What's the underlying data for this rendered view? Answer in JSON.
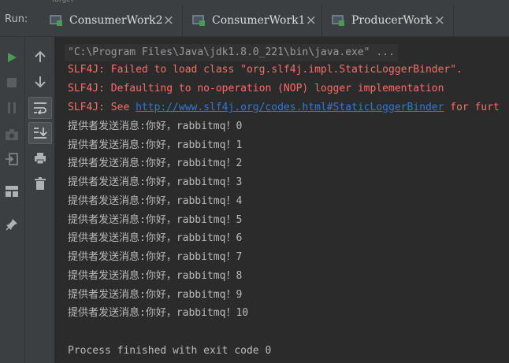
{
  "tool_window": {
    "run_label": "Run:",
    "tabs": [
      {
        "title": "ConsumerWork2"
      },
      {
        "title": "ConsumerWork1"
      },
      {
        "title": "ProducerWork"
      }
    ],
    "header_fragment": "target"
  },
  "console": {
    "command_line": "\"C:\\Program Files\\Java\\jdk1.8.0_221\\bin\\java.exe\" ...",
    "errors": [
      "SLF4J: Failed to load class \"org.slf4j.impl.StaticLoggerBinder\".",
      "SLF4J: Defaulting to no-operation (NOP) logger implementation"
    ],
    "see_prefix": "SLF4J: See ",
    "see_link": "http://www.slf4j.org/codes.html#StaticLoggerBinder",
    "see_suffix": " for furt",
    "messages": [
      "提供者发送消息:你好，rabbitmq！0",
      "提供者发送消息:你好，rabbitmq！1",
      "提供者发送消息:你好，rabbitmq！2",
      "提供者发送消息:你好，rabbitmq！3",
      "提供者发送消息:你好，rabbitmq！4",
      "提供者发送消息:你好，rabbitmq！5",
      "提供者发送消息:你好，rabbitmq！6",
      "提供者发送消息:你好，rabbitmq！7",
      "提供者发送消息:你好，rabbitmq！8",
      "提供者发送消息:你好，rabbitmq！9",
      "提供者发送消息:你好，rabbitmq！10"
    ],
    "exit_message": "Process finished with exit code 0"
  },
  "colors": {
    "error": "#ff6b68",
    "link": "#287bde",
    "run_green": "#499c54"
  },
  "icons": {
    "left_gutter": [
      "run-icon",
      "stop-icon",
      "pause-icon",
      "camera-icon",
      "exit-icon",
      "layout-icon",
      "pin-icon"
    ],
    "right_gutter": [
      "arrow-up-icon",
      "arrow-down-icon",
      "soft-wrap-icon",
      "scroll-to-end-icon",
      "print-icon",
      "trash-icon"
    ]
  }
}
